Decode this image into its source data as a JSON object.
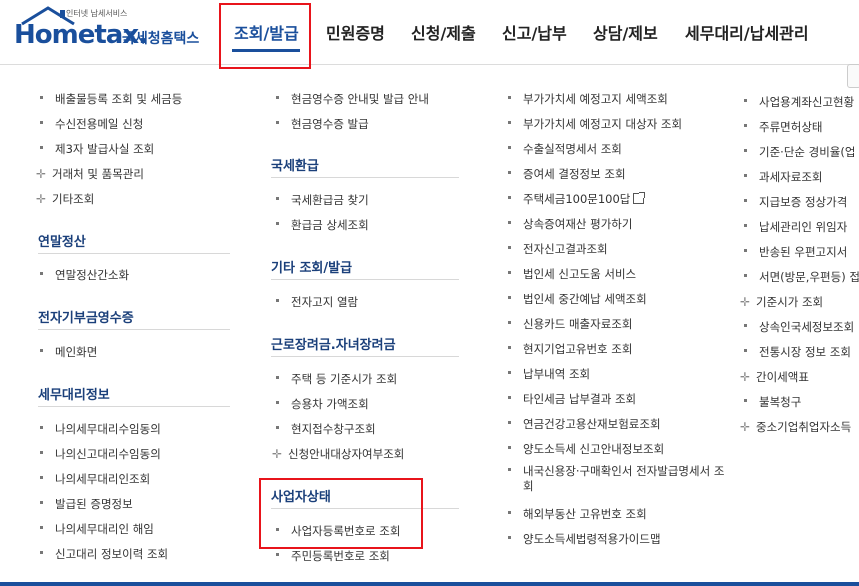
{
  "logo": {
    "subtitle": "인터넷 납세서비스",
    "main": "Hometax.",
    "org": "국세청홈택스"
  },
  "nav": [
    {
      "label": "조회/발급",
      "active": true
    },
    {
      "label": "민원증명"
    },
    {
      "label": "신청/제출"
    },
    {
      "label": "신고/납부"
    },
    {
      "label": "상담/제보"
    },
    {
      "label": "세무대리/납세관리"
    }
  ],
  "col1": {
    "top_items": [
      "배출물등록 조회 및 세금등",
      "수신전용메일 신청",
      "제3자 발급사실 조회",
      "거래처 및 품목관리",
      "기타조회"
    ],
    "sections": [
      {
        "title": "연말정산",
        "items": [
          "연말정산간소화"
        ]
      },
      {
        "title": "전자기부금영수증",
        "items": [
          "메인화면"
        ]
      },
      {
        "title": "세무대리정보",
        "items": [
          "나의세무대리수임동의",
          "나의신고대리수임동의",
          "나의세무대리인조회",
          "발급된 증명정보",
          "나의세무대리인 해임",
          "신고대리 정보이력 조회"
        ]
      }
    ]
  },
  "col2": {
    "top_items": [
      "현금영수증 안내및 발급 안내",
      "현금영수증 발급"
    ],
    "sections": [
      {
        "title": "국세환급",
        "items": [
          "국세환급금 찾기",
          "환급금 상세조회"
        ]
      },
      {
        "title": "기타 조회/발급",
        "items": [
          "전자고지 열람"
        ]
      },
      {
        "title": "근로장려금.자녀장려금",
        "items": [
          "주택 등 기준시가 조회",
          "승용차 가액조회",
          "현지접수창구조회",
          "신청안내대상자여부조회"
        ]
      },
      {
        "title": "사업자상태",
        "items": [
          "사업자등록번호로 조회",
          "주민등록번호로 조회"
        ]
      }
    ]
  },
  "col3": {
    "items": [
      "부가가치세 예정고지 세액조회",
      "부가가치세 예정고지 대상자 조회",
      "수출실적명세서 조회",
      "증여세 결정정보 조회",
      "주택세금100문100답",
      "상속증여재산 평가하기",
      "전자신고결과조회",
      "법인세 신고도움 서비스",
      "법인세 중간예납 세액조회",
      "신용카드 매출자료조회",
      "현지기업고유번호 조회",
      "납부내역 조회",
      "타인세금 납부결과 조회",
      "연금건강고용산재보험료조회",
      "양도소득세 신고안내정보조회",
      "내국신용장·구매확인서 전자발급명세서 조회",
      "해외부동산 고유번호 조회",
      "양도소득세법령적용가이드맵"
    ]
  },
  "col4": {
    "items": [
      "사업용계좌신고현황",
      "주류면허상태",
      "기준·단순 경비율(업",
      "과세자료조회",
      "지급보증 정상가격 ",
      "납세관리인 위임자 ",
      "반송된 우편고지서 ",
      "서면(방문,우편등) 접",
      "기준시가 조회",
      "상속인국세정보조회",
      "전통시장 정보 조회",
      "간이세액표",
      "불복청구",
      "중소기업취업자소득"
    ]
  }
}
